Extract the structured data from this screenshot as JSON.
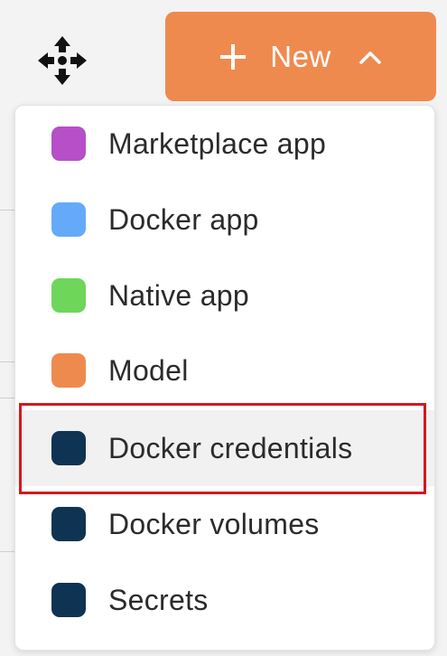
{
  "new_button": {
    "label": "New"
  },
  "menu": {
    "items": [
      {
        "label": "Marketplace app",
        "color": "#b64fc8"
      },
      {
        "label": "Docker app",
        "color": "#64aaf8"
      },
      {
        "label": "Native app",
        "color": "#6ed65a"
      },
      {
        "label": "Model",
        "color": "#ef8a4f"
      },
      {
        "label": "Docker credentials",
        "color": "#0f3352",
        "highlighted": true
      },
      {
        "label": "Docker volumes",
        "color": "#0f3352"
      },
      {
        "label": "Secrets",
        "color": "#0f3352"
      }
    ]
  },
  "icons": {
    "move": "move-arrows-icon",
    "plus": "plus-icon",
    "chevron": "chevron-up-icon"
  },
  "colors": {
    "accent": "#ef8a4f",
    "highlight_outline": "#d6171e"
  }
}
